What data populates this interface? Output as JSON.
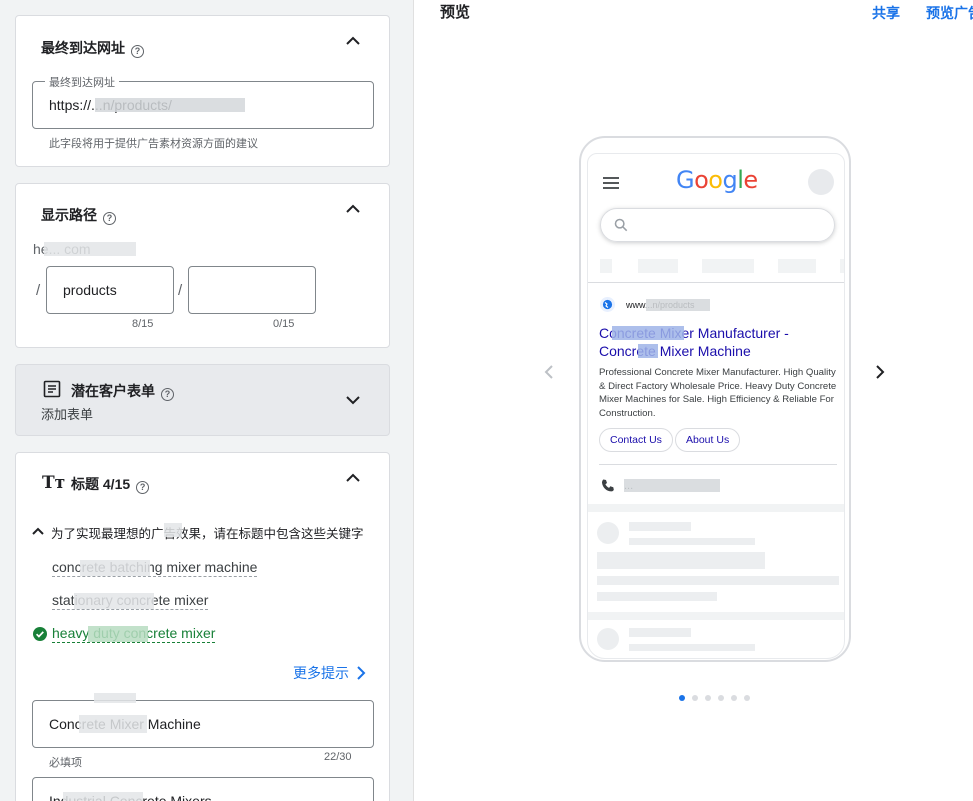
{
  "left_panel": {
    "final_url": {
      "title": "最终到达网址",
      "help": "?",
      "field_label": "最终到达网址",
      "field_value": "https://...n/products/",
      "hint": "此字段将用于提供广告素材资源方面的建议"
    },
    "display_path": {
      "title": "显示路径",
      "help": "?",
      "domain": "he... com",
      "separator": "/",
      "path1": "products",
      "path1_counter": "8/15",
      "path2": "",
      "path2_counter": "0/15"
    },
    "lead_form": {
      "title": "潜在客户表单",
      "help": "?",
      "subtitle": "添加表单"
    },
    "headlines": {
      "title": "标题 4/15",
      "help": "?",
      "icon_text": "Tт",
      "tip_heading": "为了实现最理想的广告效果，请在标题中包含这些关键字",
      "keywords": [
        {
          "text": "concrete batching mixer machine",
          "included": false
        },
        {
          "text": "stationary concrete mixer",
          "included": false
        },
        {
          "text": "heavy duty concrete mixer",
          "included": true
        }
      ],
      "more_tips": "更多提示",
      "headline1": "Concrete Mixer Machine",
      "headline1_required": "必填项",
      "headline1_counter": "22/30",
      "headline2": "Industrial Concrete Mixers"
    }
  },
  "preview": {
    "title": "预览",
    "share": "共享",
    "preview_ad": "预览广告",
    "google_logo": [
      "G",
      "o",
      "o",
      "g",
      "l",
      "e"
    ],
    "logo_colors": [
      "#4285F4",
      "#EA4335",
      "#FBBC05",
      "#4285F4",
      "#34A853",
      "#EA4335"
    ],
    "ad": {
      "url": "www...n/products",
      "title": "Concrete Mixer Manufacturer - Concrete Mixer Machine",
      "description": "Professional Concrete Mixer Manufacturer. High Quality & Direct Factory Wholesale Price. Heavy Duty Concrete Mixer Machines for Sale. High Efficiency & Reliable For Construction.",
      "sitelinks": [
        "Contact Us",
        "About Us"
      ],
      "phone": "..."
    },
    "page_indicator": {
      "total": 6,
      "active": 1
    }
  },
  "colors": {
    "accent": "#1a73e8",
    "success": "#188038",
    "link": "#1a0dab"
  }
}
